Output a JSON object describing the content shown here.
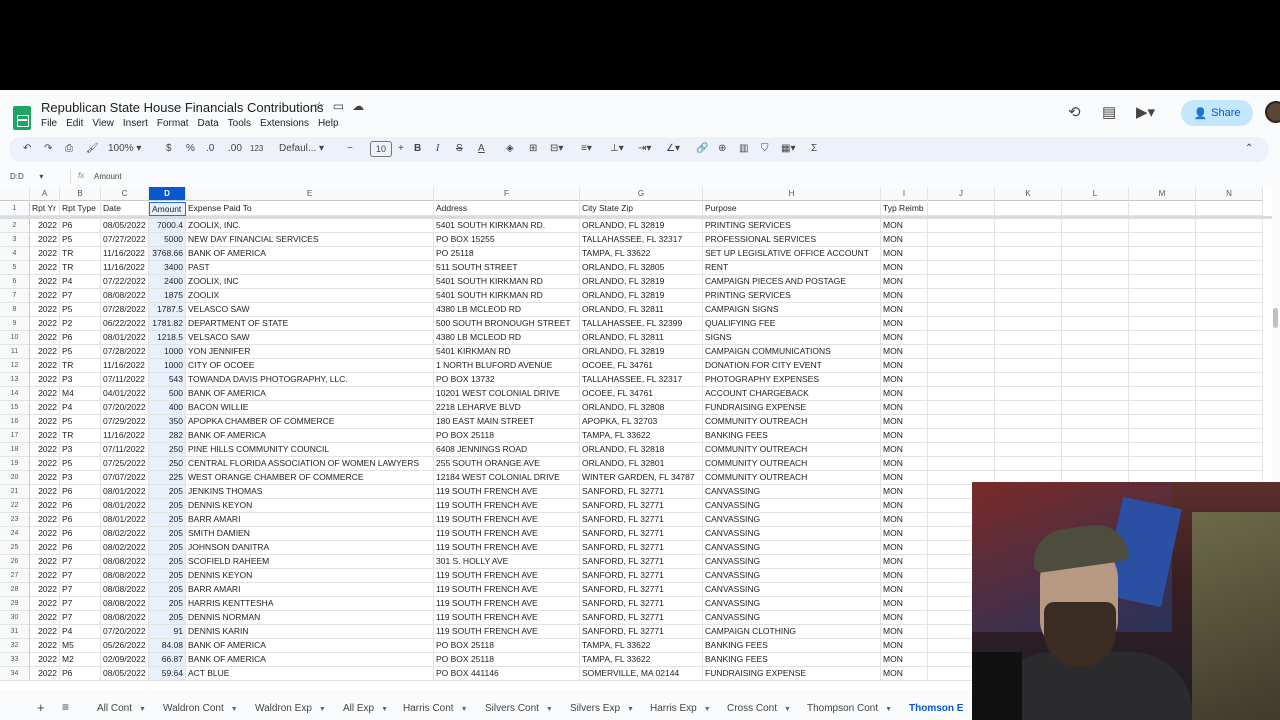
{
  "doc": {
    "title": "Republican State House Financials Contributions",
    "menu": [
      "File",
      "Edit",
      "View",
      "Insert",
      "Format",
      "Data",
      "Tools",
      "Extensions",
      "Help"
    ],
    "share_label": "Share"
  },
  "toolbar": {
    "zoom": "100%",
    "currency": "$",
    "percent": "%",
    "dec_decrease": ".0",
    "dec_increase": ".00",
    "number_format": "123",
    "font": "Defaul...",
    "font_size": "10",
    "bold": "B",
    "italic": "I",
    "strike": "S",
    "text_color": "A"
  },
  "formula_bar": {
    "cell_ref": "D:D",
    "fx": "fx",
    "value": "Amount"
  },
  "columns": [
    {
      "letter": "A",
      "header": "Rpt Yr"
    },
    {
      "letter": "B",
      "header": "Rpt Type"
    },
    {
      "letter": "C",
      "header": "Date"
    },
    {
      "letter": "D",
      "header": "Amount"
    },
    {
      "letter": "E",
      "header": "Expense Paid To"
    },
    {
      "letter": "F",
      "header": "Address"
    },
    {
      "letter": "G",
      "header": "City State Zip"
    },
    {
      "letter": "H",
      "header": "Purpose"
    },
    {
      "letter": "I",
      "header": "Typ Reimb"
    },
    {
      "letter": "J",
      "header": ""
    },
    {
      "letter": "K",
      "header": ""
    },
    {
      "letter": "L",
      "header": ""
    },
    {
      "letter": "M",
      "header": ""
    },
    {
      "letter": "N",
      "header": ""
    }
  ],
  "selected_column": "D",
  "rows": [
    [
      "2022",
      "P6",
      "08/05/2022",
      "7000.4",
      "ZOOLIX, INC.",
      "5401 SOUTH KIRKMAN RD.",
      "ORLANDO, FL 32819",
      "PRINTING SERVICES",
      "MON"
    ],
    [
      "2022",
      "P5",
      "07/27/2022",
      "5000",
      "NEW DAY FINANCIAL SERVICES",
      "PO BOX 15255",
      "TALLAHASSEE, FL 32317",
      "PROFESSIONAL SERVICES",
      "MON"
    ],
    [
      "2022",
      "TR",
      "11/16/2022",
      "3768.66",
      "BANK OF AMERICA",
      "PO 25118",
      "TAMPA, FL 33622",
      "SET UP LEGISLATIVE OFFICE ACCOUNT",
      "MON"
    ],
    [
      "2022",
      "TR",
      "11/16/2022",
      "3400",
      "PAST",
      "511 SOUTH STREET",
      "ORLANDO, FL 32805",
      "RENT",
      "MON"
    ],
    [
      "2022",
      "P4",
      "07/22/2022",
      "2400",
      "ZOOLIX, INC",
      "5401 SOUTH KIRKMAN RD",
      "ORLANDO, FL 32819",
      "CAMPAIGN PIECES AND POSTAGE",
      "MON"
    ],
    [
      "2022",
      "P7",
      "08/08/2022",
      "1875",
      "ZOOLIX",
      "5401 SOUTH KIRKMAN RD",
      "ORLANDO, FL 32819",
      "PRINTING SERVICES",
      "MON"
    ],
    [
      "2022",
      "P5",
      "07/28/2022",
      "1787.5",
      "VELASCO SAW",
      "4380 LB MCLEOD RD",
      "ORLANDO, FL 32811",
      "CAMPAIGN SIGNS",
      "MON"
    ],
    [
      "2022",
      "P2",
      "06/22/2022",
      "1781.82",
      "DEPARTMENT OF STATE",
      "500 SOUTH BRONOUGH STREET",
      "TALLAHASSEE, FL 32399",
      "QUALIFYING FEE",
      "MON"
    ],
    [
      "2022",
      "P6",
      "08/01/2022",
      "1218.5",
      "VELSACO SAW",
      "4380 LB MCLEOD RD",
      "ORLANDO, FL 32811",
      "SIGNS",
      "MON"
    ],
    [
      "2022",
      "P5",
      "07/28/2022",
      "1000",
      "YON JENNIFER",
      "5401 KIRKMAN RD",
      "ORLANDO, FL 32819",
      "CAMPAIGN COMMUNICATIONS",
      "MON"
    ],
    [
      "2022",
      "TR",
      "11/16/2022",
      "1000",
      "CITY OF OCOEE",
      "1 NORTH BLUFORD AVENUE",
      "OCOEE, FL 34761",
      "DONATION FOR CITY EVENT",
      "MON"
    ],
    [
      "2022",
      "P3",
      "07/11/2022",
      "543",
      "TOWANDA DAVIS PHOTOGRAPHY, LLC.",
      "PO BOX 13732",
      "TALLAHASSEE, FL 32317",
      "PHOTOGRAPHY EXPENSES",
      "MON"
    ],
    [
      "2022",
      "M4",
      "04/01/2022",
      "500",
      "BANK OF AMERICA",
      "10201 WEST COLONIAL DRIVE",
      "OCOEE, FL 34761",
      "ACCOUNT CHARGEBACK",
      "MON"
    ],
    [
      "2022",
      "P4",
      "07/20/2022",
      "400",
      "BACON WILLIE",
      "2218 LEHARVE BLVD",
      "ORLANDO, FL 32808",
      "FUNDRAISING EXPENSE",
      "MON"
    ],
    [
      "2022",
      "P5",
      "07/29/2022",
      "350",
      "APOPKA CHAMBER OF COMMERCE",
      "180 EAST MAIN STREET",
      "APOPKA, FL 32703",
      "COMMUNITY OUTREACH",
      "MON"
    ],
    [
      "2022",
      "TR",
      "11/16/2022",
      "282",
      "BANK OF AMERICA",
      "PO BOX 25118",
      "TAMPA, FL 33622",
      "BANKING FEES",
      "MON"
    ],
    [
      "2022",
      "P3",
      "07/11/2022",
      "250",
      "PINE HILLS COMMUNITY COUNCIL",
      "6408 JENNINGS ROAD",
      "ORLANDO, FL 32818",
      "COMMUNITY OUTREACH",
      "MON"
    ],
    [
      "2022",
      "P5",
      "07/25/2022",
      "250",
      "CENTRAL FLORIDA ASSOCIATION OF WOMEN LAWYERS",
      "255 SOUTH ORANGE AVE",
      "ORLANDO, FL 32801",
      "COMMUNITY OUTREACH",
      "MON"
    ],
    [
      "2022",
      "P3",
      "07/07/2022",
      "225",
      "WEST ORANGE CHAMBER OF COMMERCE",
      "12184 WEST COLONIAL DRIVE",
      "WINTER GARDEN, FL 34787",
      "COMMUNITY OUTREACH",
      "MON"
    ],
    [
      "2022",
      "P6",
      "08/01/2022",
      "205",
      "JENKINS THOMAS",
      "119 SOUTH FRENCH AVE",
      "SANFORD, FL 32771",
      "CANVASSING",
      "MON"
    ],
    [
      "2022",
      "P6",
      "08/01/2022",
      "205",
      "DENNIS KEYON",
      "119 SOUTH FRENCH AVE",
      "SANFORD, FL 32771",
      "CANVASSING",
      "MON"
    ],
    [
      "2022",
      "P6",
      "08/01/2022",
      "205",
      "BARR AMARI",
      "119 SOUTH FRENCH AVE",
      "SANFORD, FL 32771",
      "CANVASSING",
      "MON"
    ],
    [
      "2022",
      "P6",
      "08/02/2022",
      "205",
      "SMITH DAMIEN",
      "119 SOUTH FRENCH AVE",
      "SANFORD, FL 32771",
      "CANVASSING",
      "MON"
    ],
    [
      "2022",
      "P6",
      "08/02/2022",
      "205",
      "JOHNSON DANITRA",
      "119 SOUTH FRENCH AVE",
      "SANFORD, FL 32771",
      "CANVASSING",
      "MON"
    ],
    [
      "2022",
      "P7",
      "08/08/2022",
      "205",
      "SCOFIELD RAHEEM",
      "301 S. HOLLY AVE",
      "SANFORD, FL 32771",
      "CANVASSING",
      "MON"
    ],
    [
      "2022",
      "P7",
      "08/08/2022",
      "205",
      "DENNIS KEYON",
      "119 SOUTH FRENCH AVE",
      "SANFORD, FL 32771",
      "CANVASSING",
      "MON"
    ],
    [
      "2022",
      "P7",
      "08/08/2022",
      "205",
      "BARR AMARI",
      "119 SOUTH FRENCH AVE",
      "SANFORD, FL 32771",
      "CANVASSING",
      "MON"
    ],
    [
      "2022",
      "P7",
      "08/08/2022",
      "205",
      "HARRIS KENTTESHA",
      "119 SOUTH FRENCH AVE",
      "SANFORD, FL 32771",
      "CANVASSING",
      "MON"
    ],
    [
      "2022",
      "P7",
      "08/08/2022",
      "205",
      "DENNIS NORMAN",
      "119 SOUTH FRENCH AVE",
      "SANFORD, FL 32771",
      "CANVASSING",
      "MON"
    ],
    [
      "2022",
      "P4",
      "07/20/2022",
      "91",
      "DENNIS KARIN",
      "119 SOUTH FRENCH AVE",
      "SANFORD, FL 32771",
      "CAMPAIGN CLOTHING",
      "MON"
    ],
    [
      "2022",
      "M5",
      "05/26/2022",
      "84.08",
      "BANK OF AMERICA",
      "PO BOX 25118",
      "TAMPA, FL 33622",
      "BANKING FEES",
      "MON"
    ],
    [
      "2022",
      "M2",
      "02/09/2022",
      "66.87",
      "BANK OF AMERICA",
      "PO BOX 25118",
      "TAMPA, FL 33622",
      "BANKING FEES",
      "MON"
    ],
    [
      "2022",
      "P6",
      "08/05/2022",
      "59.64",
      "ACT BLUE",
      "PO BOX 441146",
      "SOMERVILLE, MA 02144",
      "FUNDRAISING EXPENSE",
      "MON"
    ]
  ],
  "sheet_tabs": [
    {
      "label": "All Cont",
      "active": false
    },
    {
      "label": "Waldron Cont",
      "active": false
    },
    {
      "label": "Waldron Exp",
      "active": false
    },
    {
      "label": "All Exp",
      "active": false
    },
    {
      "label": "Harris Cont",
      "active": false
    },
    {
      "label": "Silvers Cont",
      "active": false
    },
    {
      "label": "Silvers Exp",
      "active": false
    },
    {
      "label": "Harris Exp",
      "active": false
    },
    {
      "label": "Cross Cont",
      "active": false
    },
    {
      "label": "Thompson Cont",
      "active": false
    },
    {
      "label": "Thomson E",
      "active": true
    }
  ],
  "icons": {
    "star": "star-icon",
    "folder": "move-folder-icon",
    "cloud": "cloud-status-icon",
    "history": "history-icon",
    "comment": "comment-icon",
    "meet": "video-call-icon"
  }
}
